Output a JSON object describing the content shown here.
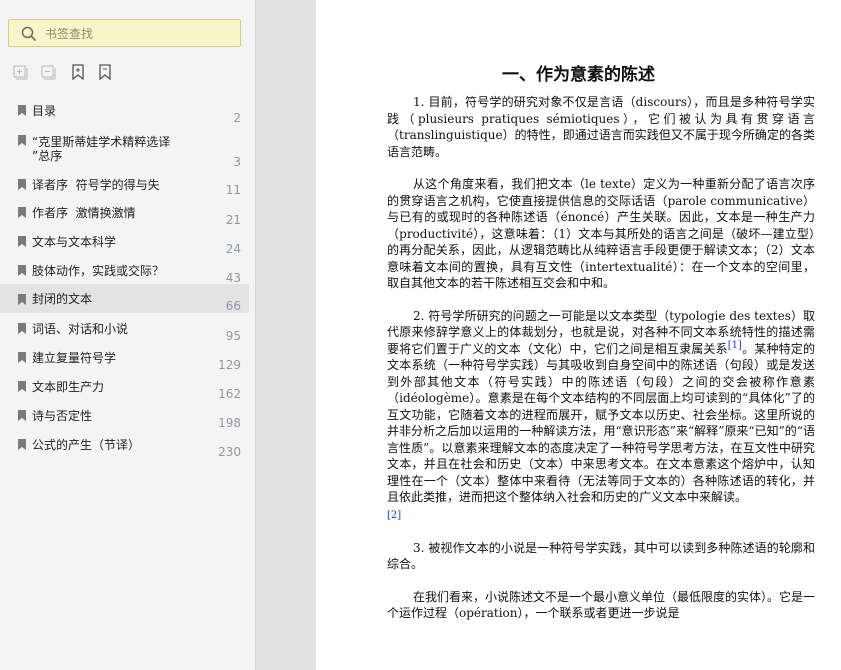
{
  "sidebar": {
    "search": {
      "placeholder": "书签查找"
    },
    "toolbar": [
      {
        "name": "expand-all-icon"
      },
      {
        "name": "collapse-all-icon"
      },
      {
        "name": "add-bookmark-icon"
      },
      {
        "name": "bookmark-settings-icon"
      }
    ],
    "bookmarks": [
      {
        "label": "目录",
        "page": "2",
        "active": false
      },
      {
        "label": "“克里斯蒂娃学术精粹选译\n”总序",
        "page": "3",
        "active": false
      },
      {
        "label": "译者序  符号学的得与失",
        "page": "11",
        "active": false
      },
      {
        "label": "作者序  激情换激情",
        "page": "21",
        "active": false
      },
      {
        "label": "文本与文本科学",
        "page": "24",
        "active": false
      },
      {
        "label": "肢体动作，实践或交际？",
        "page": "43",
        "active": false
      },
      {
        "label": "封闭的文本",
        "page": "66",
        "active": true
      },
      {
        "label": "词语、对话和小说",
        "page": "95",
        "active": false
      },
      {
        "label": "建立复量符号学",
        "page": "129",
        "active": false
      },
      {
        "label": "文本即生产力",
        "page": "162",
        "active": false
      },
      {
        "label": "诗与否定性",
        "page": "198",
        "active": false
      },
      {
        "label": "公式的产生（节译）",
        "page": "230",
        "active": false
      }
    ]
  },
  "document": {
    "title": "一、作为意素的陈述",
    "p1": "1. 目前，符号学的研究对象不仅是言语（discours），而且是多种符号学实践（plusieurs pratiques sémiotiques），它们被认为具有贯穿语言（translinguistique）的特性，即通过语言而实践但又不属于现今所确定的各类语言范畴。",
    "p2": "从这个角度来看，我们把文本（le texte）定义为一种重新分配了语言次序的贯穿语言之机构，它使直接提供信息的交际话语（parole communicative）与已有的或现时的各种陈述语（énoncé）产生关联。因此，文本是一种生产力（productivité），这意味着：（1）文本与其所处的语言之间是（破坏—建立型）的再分配关系，因此，从逻辑范畴比从纯粹语言手段更便于解读文本；（2）文本意味着文本间的置换，具有互文性（intertextualité）：在一个文本的空间里，取自其他文本的若干陈述相互交会和中和。",
    "p3a": "2. 符号学所研究的问题之一可能是以文本类型（typologie des textes）取代原来修辞学意义上的体裁划分，也就是说，对各种不同文本系统特性的描述需要将它们置于广义的文本（文化）中，它们之间是相互隶属关系",
    "fn1": "[1]",
    "p3b": "。某种特定的文本系统（一种符号学实践）与其吸收到自身空间中的陈述语（句段）或是发送到外部其他文本（符号实践）中的陈述语（句段）之间的交会被称作意素（idéologème）。意素是在每个文本结构的不同层面上均可读到的“具体化”了的互文功能，它随着文本的进程而展开，赋予文本以历史、社会坐标。这里所说的并非分析之后加以运用的一种解读方法，用“意识形态”来“解释”原来“已知”的“语言性质”。以意素来理解文本的态度决定了一种符号学思考方法，在互文性中研究文本，并且在社会和历史（文本）中来思考文本。在文本意素这个熔炉中，认知理性在一个（文本）整体中来看待（无法等同于文本的）各种陈述语的转化，并且依此类推，进而把这个整体纳入社会和历史的广义文本中来解读。",
    "fn2": "[2]",
    "p4": "3. 被视作文本的小说是一种符号学实践，其中可以读到多种陈述语的轮廓和综合。",
    "p5": "在我们看来，小说陈述文不是一个最小意义单位（最低限度的实体）。它是一个运作过程（opération），一个联系或者更进一步说是"
  }
}
